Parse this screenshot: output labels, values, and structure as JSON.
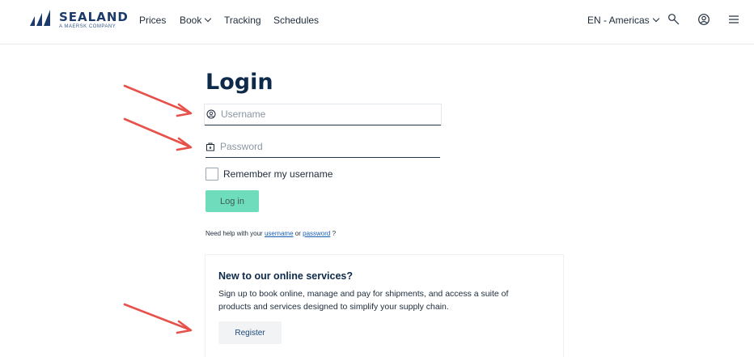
{
  "brand": {
    "name": "SEALAND",
    "tagline": "A MAERSK COMPANY",
    "color": "#1c3a6b"
  },
  "nav": {
    "items": [
      {
        "label": "Prices",
        "has_dropdown": false
      },
      {
        "label": "Book",
        "has_dropdown": true
      },
      {
        "label": "Tracking",
        "has_dropdown": false
      },
      {
        "label": "Schedules",
        "has_dropdown": false
      }
    ],
    "language": "EN - Americas",
    "icons": [
      "search-icon",
      "user-icon",
      "menu-icon"
    ]
  },
  "login": {
    "title": "Login",
    "username_placeholder": "Username",
    "username_value": "",
    "password_placeholder": "Password",
    "password_value": "",
    "remember_label": "Remember my username",
    "remember_checked": false,
    "submit_label": "Log in",
    "submit_color": "#6fdcbc",
    "help_prefix": "Need help with your",
    "help_username": "username",
    "help_or": "or",
    "help_password": "password",
    "help_suffix": "?"
  },
  "signup": {
    "title": "New to our online services?",
    "text": "Sign up to book online, manage and pay for shipments, and access a suite of products and services designed to simplify your supply chain.",
    "button_label": "Register"
  },
  "annotation": {
    "arrow_color": "#e8504a",
    "arrow_count": 3
  }
}
